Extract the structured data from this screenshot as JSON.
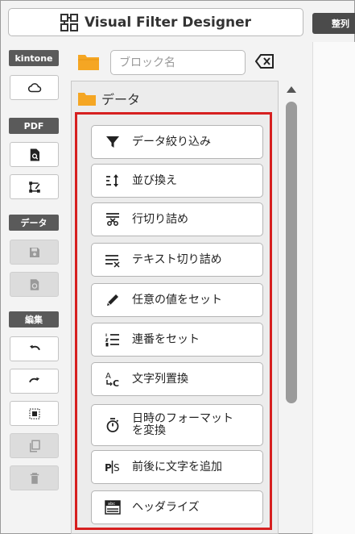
{
  "title": "Visual Filter Designer",
  "right_tab": "整列",
  "left": {
    "kintone_label": "kintone",
    "pdf_label": "PDF",
    "data_label": "データ",
    "edit_label": "編集"
  },
  "search": {
    "placeholder": "ブロック名",
    "value": ""
  },
  "panel": {
    "title": "データ",
    "items": [
      {
        "label": "データ絞り込み",
        "icon": "filter-icon"
      },
      {
        "label": "並び換え",
        "icon": "sort-icon"
      },
      {
        "label": "行切り詰め",
        "icon": "row-trim-icon"
      },
      {
        "label": "テキスト切り詰め",
        "icon": "text-trim-icon"
      },
      {
        "label": "任意の値をセット",
        "icon": "pencil-icon"
      },
      {
        "label": "連番をセット",
        "icon": "numbered-list-icon"
      },
      {
        "label": "文字列置換",
        "icon": "replace-icon"
      },
      {
        "label": "日時のフォーマット\nを変換",
        "icon": "timer-icon"
      },
      {
        "label": "前後に文字を追加",
        "icon": "add-text-icon"
      },
      {
        "label": "ヘッダライズ",
        "icon": "header-icon"
      }
    ]
  },
  "colors": {
    "highlight": "#d62020",
    "folder": "#f5a623",
    "section_label": "#5a5a5a"
  }
}
